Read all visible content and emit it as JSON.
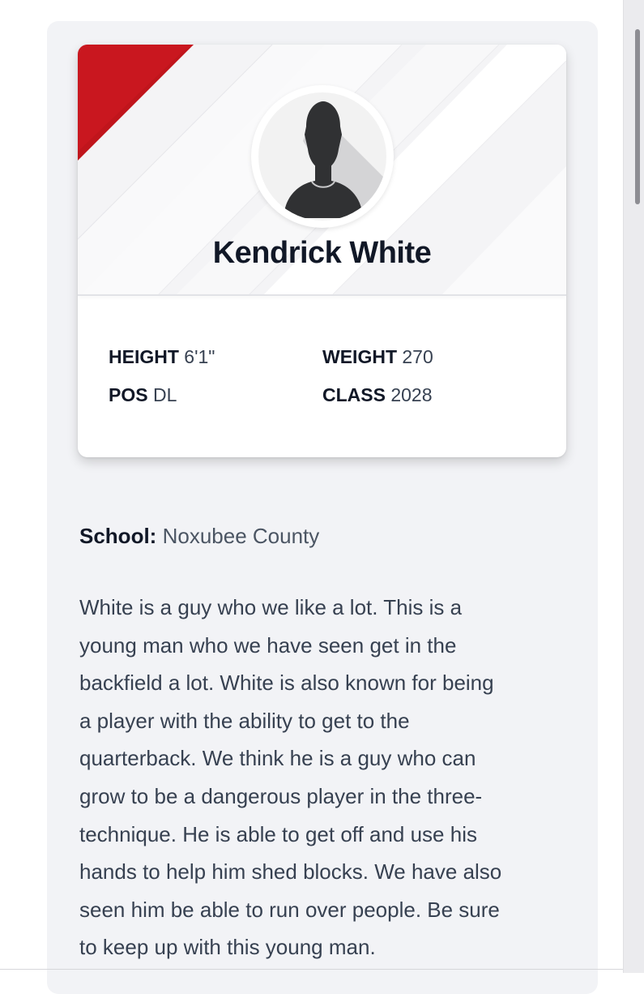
{
  "player": {
    "name": "Kendrick White",
    "stats": {
      "height_label": "HEIGHT",
      "height_value": "6'1\"",
      "weight_label": "WEIGHT",
      "weight_value": "270",
      "pos_label": "POS",
      "pos_value": "DL",
      "class_label": "CLASS",
      "class_value": "2028"
    },
    "school_label": "School:",
    "school_value": "Noxubee County",
    "bio_lines": [
      "White is a guy who we like a lot. This is a",
      "young man who we have seen get in the",
      "backfield a lot. White is also known for being",
      "a player with the ability to get to the",
      "quarterback. We think he is a guy who can",
      "grow to be a dangerous player in the three-",
      "technique. He is able to get off and use his",
      "hands to help him shed blocks. We have also",
      "seen him be able to run over people. Be sure",
      "to keep up with this young man."
    ]
  },
  "icons": {
    "avatar": "person-silhouette-icon"
  },
  "colors": {
    "accent": "#c0151c",
    "card_bg": "#f2f3f6",
    "name_text": "#111827"
  }
}
